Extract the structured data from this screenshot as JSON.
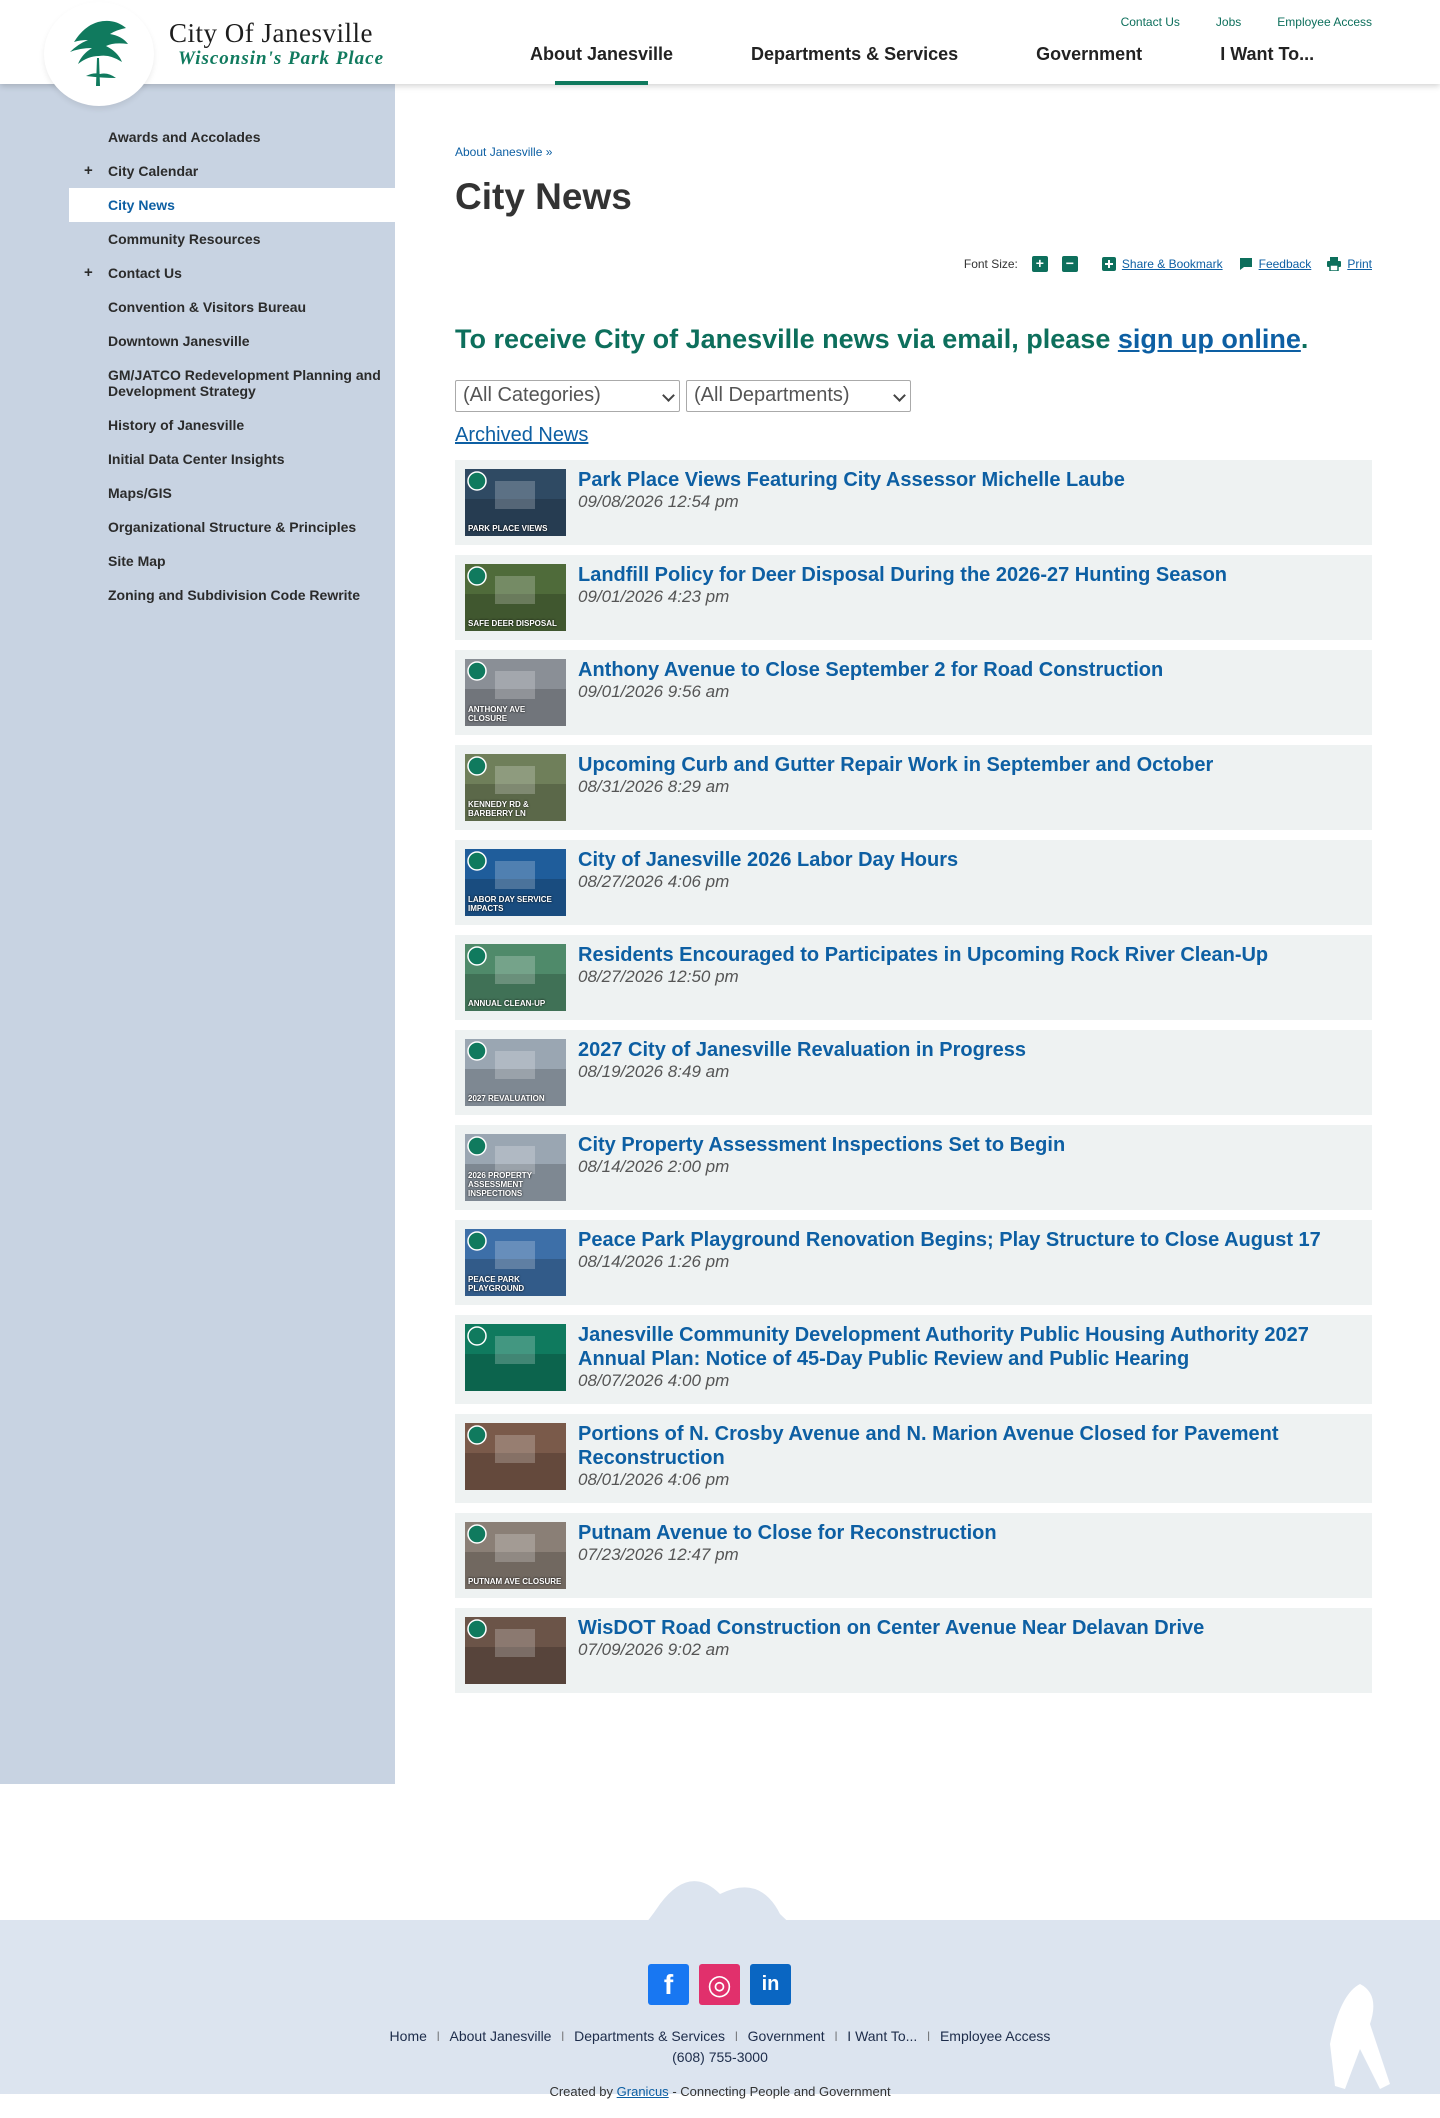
{
  "header": {
    "logo_title": "City Of Janesville",
    "logo_tagline": "Wisconsin's Park Place",
    "utility_links": [
      "Contact Us",
      "Jobs",
      "Employee Access"
    ],
    "main_nav": [
      "About Janesville",
      "Departments & Services",
      "Government",
      "I Want To..."
    ],
    "active_nav": "About Janesville"
  },
  "sidebar": {
    "items": [
      {
        "label": "Awards and Accolades",
        "expandable": false
      },
      {
        "label": "City Calendar",
        "expandable": true
      },
      {
        "label": "City News",
        "expandable": false,
        "active": true
      },
      {
        "label": "Community Resources",
        "expandable": false
      },
      {
        "label": "Contact Us",
        "expandable": true
      },
      {
        "label": "Convention & Visitors Bureau",
        "expandable": false
      },
      {
        "label": "Downtown Janesville",
        "expandable": false
      },
      {
        "label": "GM/JATCO Redevelopment Planning and Development Strategy",
        "expandable": false
      },
      {
        "label": "History of Janesville",
        "expandable": false
      },
      {
        "label": "Initial Data Center Insights",
        "expandable": false
      },
      {
        "label": "Maps/GIS",
        "expandable": false
      },
      {
        "label": "Organizational Structure & Principles",
        "expandable": false
      },
      {
        "label": "Site Map",
        "expandable": false
      },
      {
        "label": "Zoning and Subdivision Code Rewrite",
        "expandable": false
      }
    ]
  },
  "content": {
    "breadcrumb": "About Janesville »",
    "title": "City News",
    "tools": {
      "font_size_label": "Font Size:",
      "increase": "+",
      "decrease": "−",
      "share": "Share & Bookmark",
      "feedback": "Feedback",
      "print": "Print"
    },
    "signup_text": "To receive City of Janesville news via email, please",
    "signup_link": "sign up online",
    "signup_end": ".",
    "category_select": "(All Categories)",
    "department_select": "(All Departments)",
    "archived_link": "Archived News",
    "news": [
      {
        "title": "Park Place Views Featuring City Assessor Michelle Laube",
        "date": "09/08/2026 12:54 pm",
        "thumb_caption": "PARK PLACE VIEWS",
        "thumb_color": "#2f4a63"
      },
      {
        "title": "Landfill Policy for Deer Disposal During the 2026-27 Hunting Season",
        "date": "09/01/2026 4:23 pm",
        "thumb_caption": "SAFE DEER DISPOSAL",
        "thumb_color": "#4f6b3a"
      },
      {
        "title": "Anthony Avenue to Close September 2 for Road Construction",
        "date": "09/01/2026 9:56 am",
        "thumb_caption": "ANTHONY AVE CLOSURE",
        "thumb_color": "#8a8f96"
      },
      {
        "title": "Upcoming Curb and Gutter Repair Work in September and October",
        "date": "08/31/2026 8:29 am",
        "thumb_caption": "KENNEDY RD & BARBERRY LN",
        "thumb_color": "#6f7f5a"
      },
      {
        "title": "City of Janesville 2026 Labor Day Hours",
        "date": "08/27/2026 4:06 pm",
        "thumb_caption": "LABOR DAY SERVICE IMPACTS",
        "thumb_color": "#1f5d9b"
      },
      {
        "title": "Residents Encouraged to Participates in Upcoming Rock River Clean-Up",
        "date": "08/27/2026 12:50 pm",
        "thumb_caption": "ANNUAL CLEAN-UP",
        "thumb_color": "#4f8a6a"
      },
      {
        "title": "2027 City of Janesville Revaluation in Progress",
        "date": "08/19/2026 8:49 am",
        "thumb_caption": "2027 REVALUATION",
        "thumb_color": "#9aa6b2"
      },
      {
        "title": "City Property Assessment Inspections Set to Begin",
        "date": "08/14/2026 2:00 pm",
        "thumb_caption": "2026 PROPERTY ASSESSMENT INSPECTIONS",
        "thumb_color": "#9aa6b2"
      },
      {
        "title": "Peace Park Playground Renovation Begins; Play Structure to Close August 17",
        "date": "08/14/2026 1:26 pm",
        "thumb_caption": "PEACE PARK PLAYGROUND",
        "thumb_color": "#3d6fa8"
      },
      {
        "title": "Janesville Community Development Authority Public Housing Authority 2027 Annual Plan: Notice of 45-Day Public Review and Public Hearing",
        "date": "08/07/2026 4:00 pm",
        "thumb_caption": "",
        "thumb_color": "#0f7a5e",
        "tall": true
      },
      {
        "title": "Portions of N. Crosby Avenue and N. Marion Avenue Closed for Pavement Reconstruction",
        "date": "08/01/2026 4:06 pm",
        "thumb_caption": "",
        "thumb_color": "#7a5a4a",
        "tall": true
      },
      {
        "title": "Putnam Avenue to Close for Reconstruction",
        "date": "07/23/2026 12:47 pm",
        "thumb_caption": "PUTNAM AVE CLOSURE",
        "thumb_color": "#8a7f76"
      },
      {
        "title": "WisDOT Road Construction on Center Avenue Near Delavan Drive",
        "date": "07/09/2026 9:02 am",
        "thumb_caption": "",
        "thumb_color": "#6b5448"
      }
    ]
  },
  "footer": {
    "links": [
      "Home",
      "About Janesville",
      "Departments & Services",
      "Government",
      "I Want To...",
      "Employee Access"
    ],
    "phone": "(608) 755-3000",
    "credit_prefix": "Created by",
    "credit_link": "Granicus",
    "credit_suffix": "- Connecting People and Government",
    "social": [
      {
        "name": "facebook-icon",
        "glyph": "f",
        "color": "#1877f2"
      },
      {
        "name": "instagram-icon",
        "glyph": "◎",
        "color": "#e1306c"
      },
      {
        "name": "linkedin-icon",
        "glyph": "in",
        "color": "#0a66c2"
      }
    ]
  }
}
